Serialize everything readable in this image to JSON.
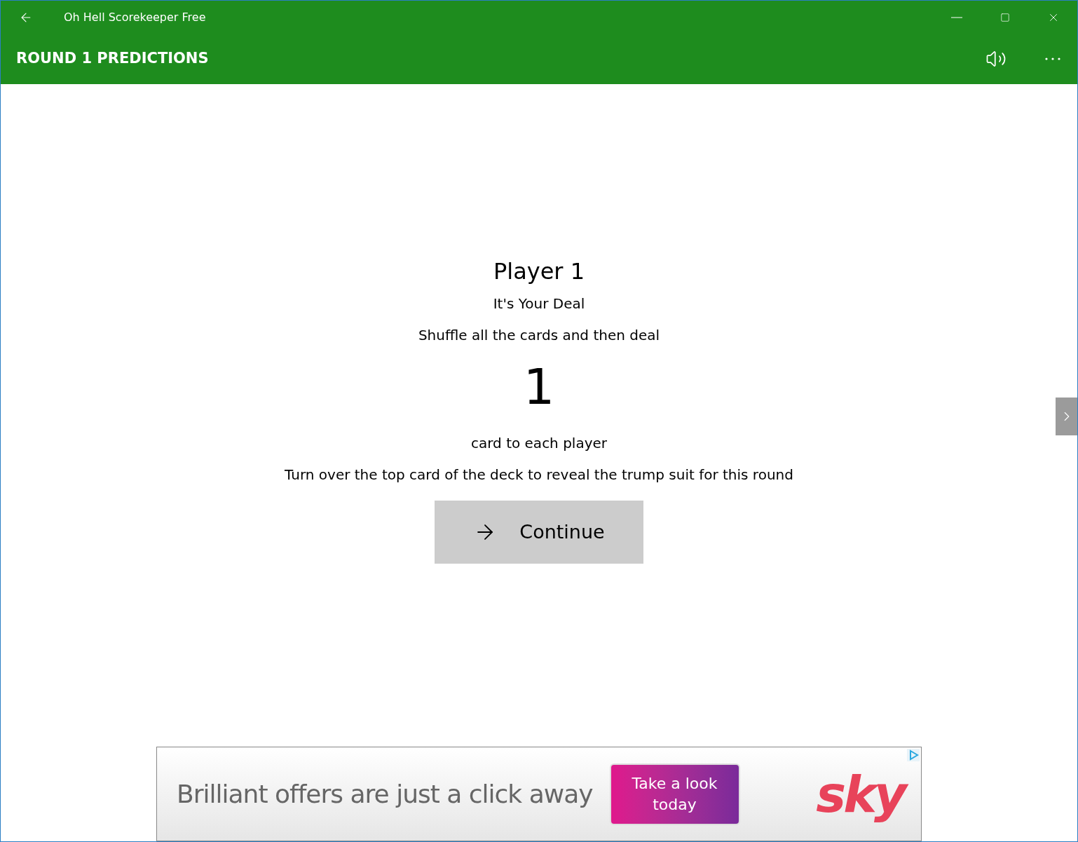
{
  "window": {
    "title": "Oh Hell Scorekeeper Free"
  },
  "header": {
    "title": "ROUND 1 PREDICTIONS"
  },
  "content": {
    "player": "Player 1",
    "deal_notice": "It's Your Deal",
    "instruction": "Shuffle all the cards and then deal",
    "card_count": "1",
    "card_caption": "card to each player",
    "trump_instruction": "Turn over the top card of the deck to reveal the trump suit for this round",
    "continue_button": "Continue"
  },
  "ad": {
    "headline": "Brilliant offers are just a click away",
    "cta": "Take a look today",
    "logo": "sky"
  }
}
